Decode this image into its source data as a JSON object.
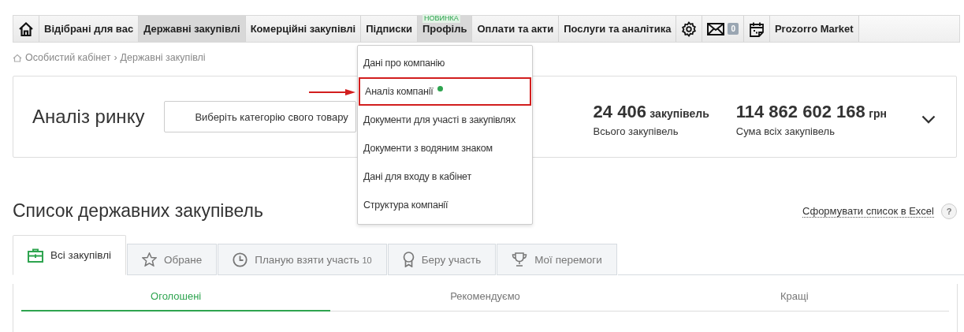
{
  "nav": [
    {
      "kind": "home",
      "selected": false
    },
    {
      "kind": "text",
      "label": "Відібрані для вас",
      "selected": false
    },
    {
      "kind": "text",
      "label": "Державні закупівлі",
      "selected": true
    },
    {
      "kind": "text",
      "label": "Комерційні закупівлі",
      "selected": false
    },
    {
      "kind": "text",
      "label": "Підписки",
      "selected": false
    },
    {
      "kind": "text",
      "label": "Профіль",
      "badge": "НОВИНКА",
      "selected": true
    },
    {
      "kind": "text",
      "label": "Оплати та акти",
      "selected": false
    },
    {
      "kind": "text",
      "label": "Послуги та аналітика",
      "selected": false
    },
    {
      "kind": "settings",
      "selected": false
    },
    {
      "kind": "mail",
      "count": "0",
      "selected": false
    },
    {
      "kind": "calendar",
      "selected": false
    },
    {
      "kind": "text",
      "label": "Prozorro Market",
      "selected": false
    }
  ],
  "breadcrumb": [
    "Особистий кабінет",
    "›",
    "Державні закупівлі"
  ],
  "market": {
    "title": "Аналіз ринку",
    "category_button": "Виберіть категорію свого товару",
    "stats": [
      {
        "value": "24 406",
        "unit": "закупівель",
        "caption": "Всього закупівель"
      },
      {
        "value": "114 862 602 168",
        "unit": "грн",
        "caption": "Сума всіх закупівель"
      }
    ]
  },
  "profile_menu": [
    {
      "label": "Дані про компанію",
      "highlighted": false,
      "new": false
    },
    {
      "label": "Аналіз компанії",
      "highlighted": true,
      "new": true
    },
    {
      "label": "Документи для участі в закупівлях",
      "highlighted": false,
      "new": false
    },
    {
      "label": "Документи з водяним знаком",
      "highlighted": false,
      "new": false
    },
    {
      "label": "Дані для входу в кабінет",
      "highlighted": false,
      "new": false
    },
    {
      "label": "Структура компанії",
      "highlighted": false,
      "new": false
    }
  ],
  "list": {
    "title": "Список державних закупівель",
    "excel_link": "Сформувати список в Excel",
    "help": "?"
  },
  "tabs": [
    {
      "kind": "briefcase",
      "label": "Всі закупівлі",
      "selected": true
    },
    {
      "kind": "star",
      "label": "Обране",
      "selected": false
    },
    {
      "kind": "clock",
      "label": "Планую взяти участь",
      "count": "10",
      "selected": false
    },
    {
      "kind": "medal",
      "label": "Беру участь",
      "selected": false
    },
    {
      "kind": "trophy",
      "label": "Мої перемоги",
      "selected": false
    }
  ],
  "subtabs": [
    {
      "label": "Оголошені",
      "selected": true
    },
    {
      "label": "Рекомендуємо",
      "selected": false
    },
    {
      "label": "Кращі",
      "selected": false
    }
  ]
}
